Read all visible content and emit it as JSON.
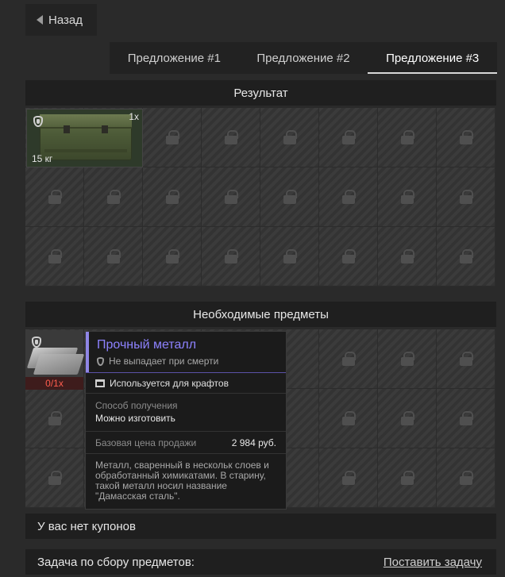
{
  "back_button": {
    "label": "Назад",
    "icon": "triangle-left-icon"
  },
  "tabs": [
    {
      "label": "Предложение #1",
      "active": false
    },
    {
      "label": "Предложение #2",
      "active": false
    },
    {
      "label": "Предложение #3",
      "active": true
    }
  ],
  "result_section": {
    "title": "Результат",
    "item": {
      "name_icon": "ammo-crate",
      "quantity": "1x",
      "weight": "15 кг"
    }
  },
  "required_section": {
    "title": "Необходимые предметы",
    "item": {
      "name_icon": "metal-sheets",
      "count": "0/1x"
    }
  },
  "tooltip": {
    "title": "Прочный металл",
    "subtitle": "Не выпадает при смерти",
    "usage": "Используется для крафтов",
    "method_label": "Способ получения",
    "method_value": "Можно изготовить",
    "price_label": "Базовая цена продажи",
    "price_value": "2 984 руб.",
    "description": "Металл, сваренный в нескольк слоев и обработанный химикатами. В старину, такой металл носил название \"Дамасская сталь\"."
  },
  "coupons_text": "У вас нет купонов",
  "task": {
    "label": "Задача по сбору предметов:",
    "action": "Поставить задачу"
  },
  "colors": {
    "accent": "#8d82ff",
    "missing": "#ff5d4e"
  }
}
